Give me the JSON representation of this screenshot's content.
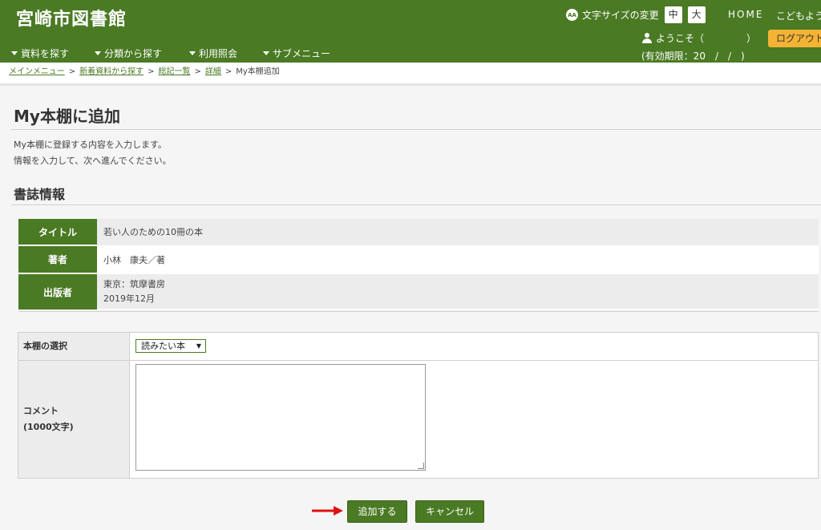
{
  "header": {
    "site_title": "宮崎市図書館",
    "fontsize_label": "文字サイズの変更",
    "fontsize_icon_text": "AA",
    "fontsize_options": [
      "中",
      "大"
    ],
    "home_label": "HOME",
    "kids_label": "こどもよう",
    "welcome_label": "ようこそ（",
    "welcome_close": "）",
    "logout_label": "ログアウト",
    "expiry_label": "(有効期限：20　/　/　)",
    "nav": [
      "資料を探す",
      "分類から探す",
      "利用照会",
      "サブメニュー"
    ]
  },
  "breadcrumb": {
    "items": [
      "メインメニュー",
      "新着資料から探す",
      "総記一覧",
      "詳細"
    ],
    "current": "My本棚追加",
    "separator": ">"
  },
  "page": {
    "title": "My本棚に追加",
    "desc_line1": "My本棚に登録する内容を入力します。",
    "desc_line2": "情報を入力して、次へ進んでください。",
    "section_title": "書誌情報"
  },
  "bib": {
    "title_label": "タイトル",
    "title_value": "若い人のための10冊の本",
    "author_label": "著者",
    "author_value": "小林　康夫／著",
    "publisher_label": "出版者",
    "publisher_line1": "東京：筑摩書房",
    "publisher_line2": "2019年12月"
  },
  "form": {
    "shelf_label": "本棚の選択",
    "shelf_selected": "読みたい本",
    "comment_label_line1": "コメント",
    "comment_label_line2": "(1000文字)",
    "comment_value": ""
  },
  "buttons": {
    "add_label": "追加する",
    "cancel_label": "キャンセル"
  },
  "colors": {
    "brand_green": "#4a7a23",
    "logout_orange": "#f5b335",
    "arrow_red": "#e01010"
  }
}
